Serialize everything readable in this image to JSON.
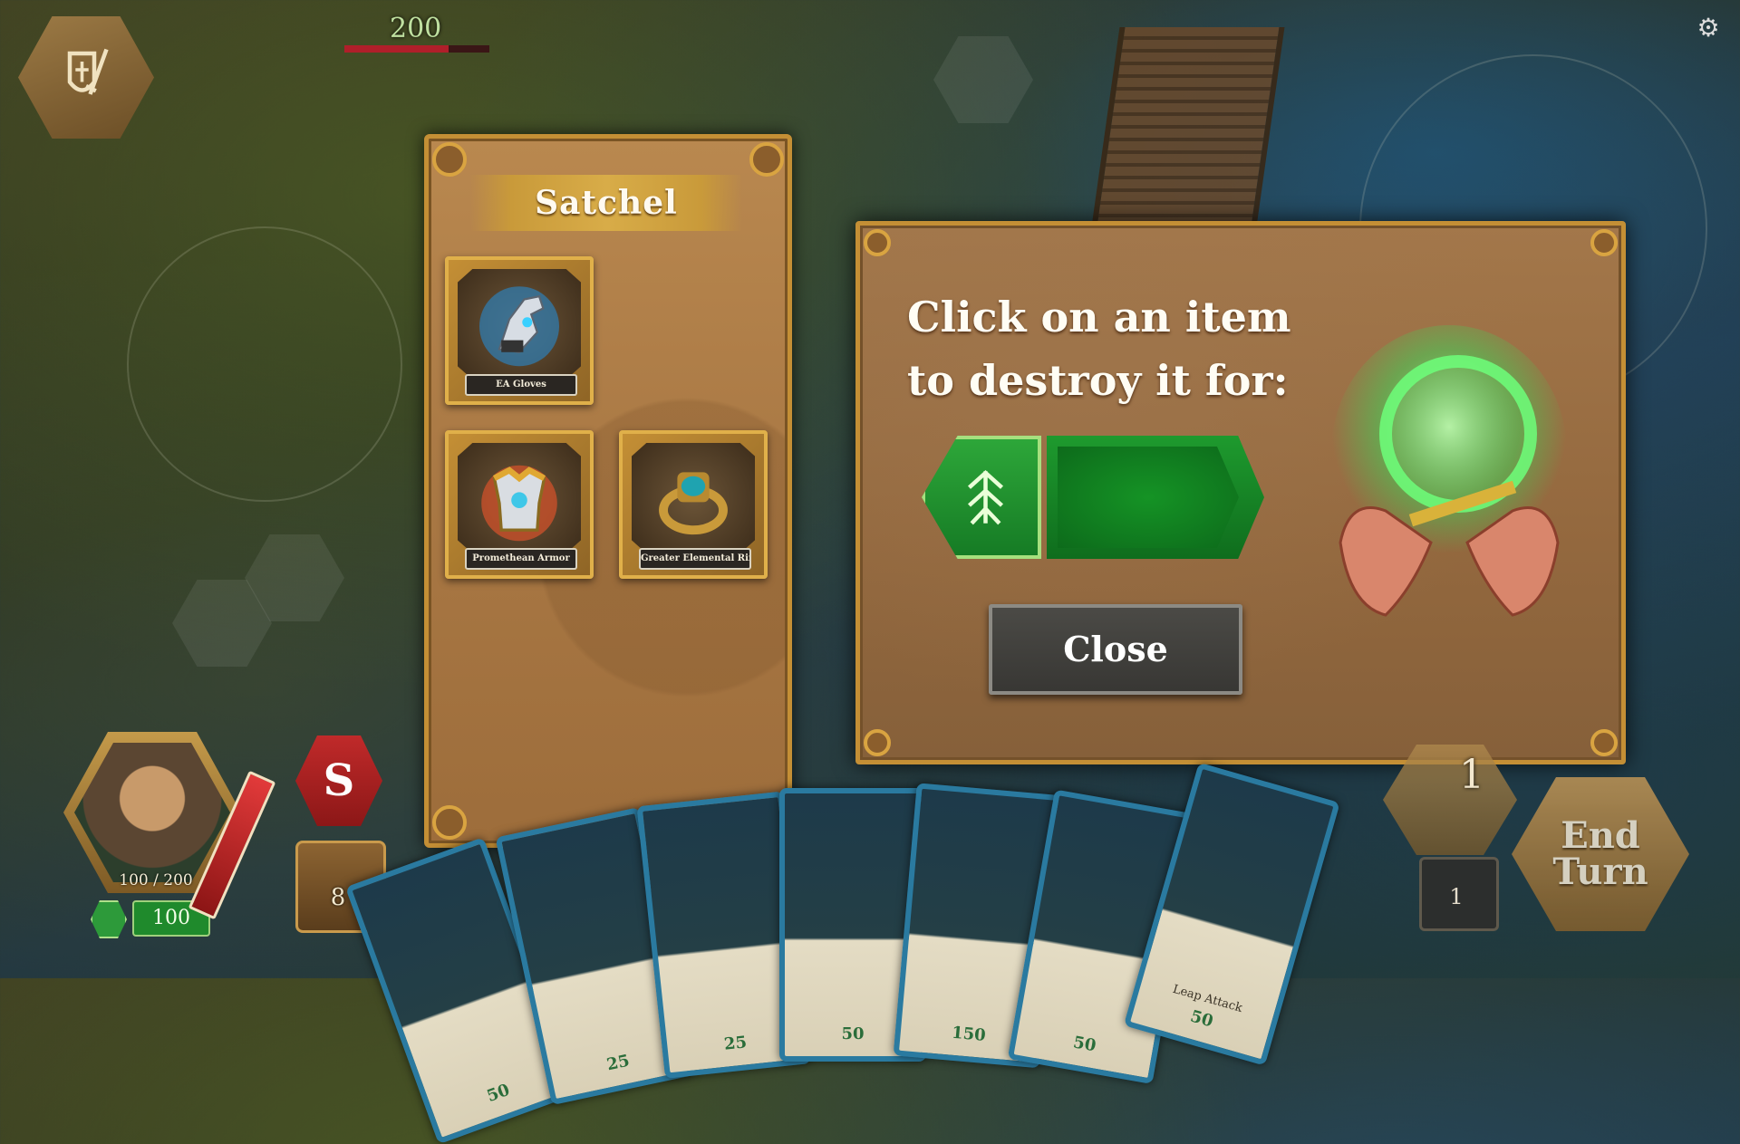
{
  "hud": {
    "boss_hp_value": "200",
    "boss_hp_fraction": 0.72,
    "settings_icon": "gear-icon",
    "emblem_icon": "shield-sword-icon"
  },
  "satchel": {
    "title": "Satchel",
    "items": [
      {
        "name": "EA Gloves",
        "icon": "gauntlet-icon"
      },
      {
        "name": "Promethean Armor",
        "icon": "armor-icon"
      },
      {
        "name": "Greater Elemental Ring",
        "icon": "ring-icon"
      }
    ]
  },
  "destroy_dialog": {
    "instruction_line1": "Click on an item",
    "instruction_line2": "to destroy it for:",
    "reward_icon": "energy-rune-icon",
    "close_label": "Close",
    "art_icon": "glowing-hands-icon"
  },
  "player": {
    "hp_text": "100 / 200",
    "energy_value": "100",
    "status_letter": "S",
    "deck_count": "8"
  },
  "hand": {
    "card_costs": [
      "50",
      "25",
      "25",
      "50",
      "150",
      "50",
      "50"
    ],
    "last_card_title": "Leap Attack"
  },
  "turn": {
    "moves_remaining": "1",
    "discard_count": "1",
    "end_turn_line1": "End",
    "end_turn_line2": "Turn"
  },
  "colors": {
    "panel_border": "#c48f35",
    "reward_green": "#1e9a2e",
    "boss_hp_red": "#b01f2a"
  }
}
